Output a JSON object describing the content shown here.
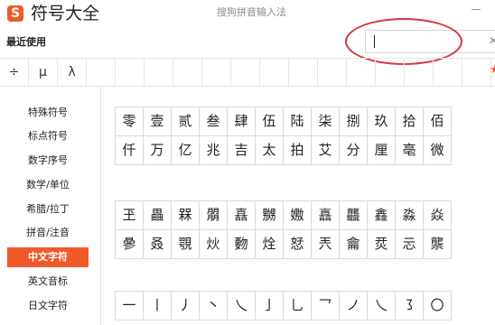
{
  "title_bar": {
    "logo": "S",
    "app_title": "符号大全",
    "ime_title": "搜狗拼音输入法"
  },
  "recent": {
    "label": "最近使用",
    "symbols": [
      "÷",
      "μ",
      "λ",
      "",
      "",
      "",
      "",
      "",
      "",
      "",
      "",
      "",
      "",
      "",
      "",
      "",
      ""
    ]
  },
  "search": {
    "value": "",
    "placeholder": "",
    "close_icon": "✕"
  },
  "sidebar": {
    "items": [
      {
        "label": "特殊符号",
        "active": false
      },
      {
        "label": "标点符号",
        "active": false
      },
      {
        "label": "数字序号",
        "active": false
      },
      {
        "label": "数学/单位",
        "active": false
      },
      {
        "label": "希腊/拉丁",
        "active": false
      },
      {
        "label": "拼音/注音",
        "active": false
      },
      {
        "label": "中文字符",
        "active": true
      },
      {
        "label": "英文音标",
        "active": false
      },
      {
        "label": "日文字符",
        "active": false
      }
    ]
  },
  "grids": [
    {
      "rows": [
        [
          "零",
          "壹",
          "贰",
          "叁",
          "肆",
          "伍",
          "陆",
          "柒",
          "捌",
          "玖",
          "拾",
          "佰"
        ],
        [
          "仟",
          "万",
          "亿",
          "兆",
          "吉",
          "太",
          "拍",
          "艾",
          "分",
          "厘",
          "亳",
          "微"
        ]
      ]
    },
    {
      "rows": [
        [
          "玊",
          "畾",
          "槑",
          "朤",
          "嚞",
          "嬲",
          "嫐",
          "譶",
          "龘",
          "鑫",
          "淼",
          "焱"
        ],
        [
          "曑",
          "叒",
          "覨",
          "炏",
          "覅",
          "烇",
          "恏",
          "兲",
          "龠",
          "烎",
          "忈",
          "龒"
        ]
      ]
    },
    {
      "rows": [
        [
          "一",
          "丨",
          "丿",
          "丶",
          "乀",
          "亅",
          "乚",
          "乛",
          "ノ",
          "乀",
          "㇌",
          "〇"
        ]
      ]
    }
  ],
  "colors": {
    "accent": "#f05a28",
    "highlight_circle": "#d9363c"
  }
}
